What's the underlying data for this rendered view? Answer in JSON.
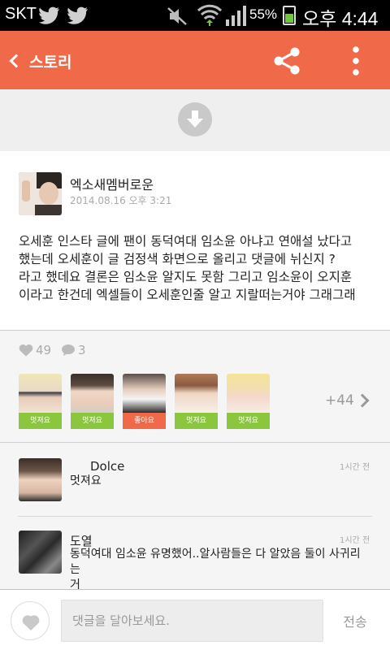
{
  "status_bar": {
    "carrier": "SKT",
    "battery": "55%",
    "battery_level": 0.55,
    "time": "오후 4:44",
    "icons": [
      "twitter-icon",
      "twitter-icon",
      "mute-icon",
      "wifi-icon",
      "signal-icon",
      "battery-icon"
    ]
  },
  "header": {
    "title": "스토리",
    "icons": [
      "back-icon",
      "share-icon",
      "more-vertical-icon"
    ],
    "color": "#f06a4a"
  },
  "download": {
    "icon": "download-icon"
  },
  "post": {
    "author": "엑소새멤버로운",
    "date": "2014.08.16 오후 3:21",
    "body_lines": [
      "오세훈 인스타 글에 팬이 동덕여대 임소윤 아냐고 연애설 났다고",
      "했는데 오세훈이 글 검정색 화면으로 올리고 댓글에 뉘신지 ?",
      "라고 했데요 결론은 임소윤 알지도 못함 그리고 임소윤이 오지훈",
      "이라고 한건데 엑셀들이 오세훈인줄 알고 지랄떠는거야 그래그래"
    ]
  },
  "stats": {
    "likes": "49",
    "comments": "3",
    "likers": [
      {
        "tag": "멋져요",
        "color": "#8cc63f"
      },
      {
        "tag": "멋져요",
        "color": "#8cc63f"
      },
      {
        "tag": "좋아요",
        "color": "#f06a4a"
      },
      {
        "tag": "멋져요",
        "color": "#8cc63f"
      },
      {
        "tag": "멋져요",
        "color": "#8cc63f"
      }
    ],
    "more": "+44"
  },
  "comments": [
    {
      "name": "Dolce",
      "time": "1시간 전",
      "text": "멋져요"
    },
    {
      "name": "도열",
      "time": "1시간 전",
      "text_lines": [
        "동덕여대 임소윤 유명했어..알사람들은 다 알았음 둘이 사귀리는",
        "거"
      ]
    }
  ],
  "input": {
    "placeholder": "댓글을 달아보세요.",
    "send_label": "전송"
  }
}
